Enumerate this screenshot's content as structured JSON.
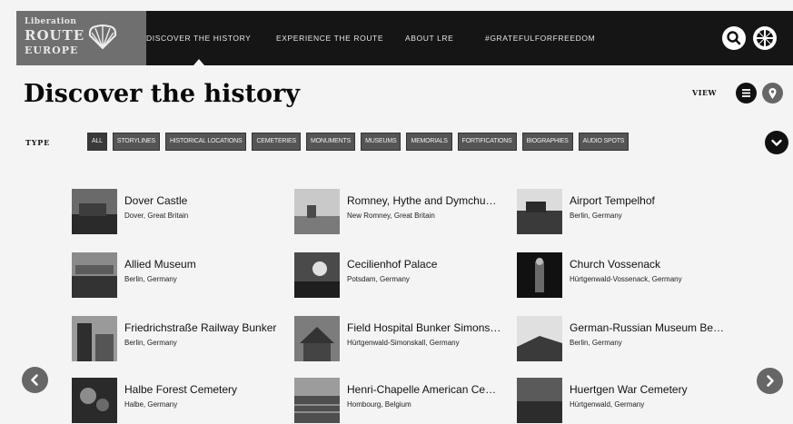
{
  "header": {
    "logo": {
      "line1": "Liberation",
      "line2": "ROUTE",
      "line3": "EUROPE"
    },
    "nav": [
      {
        "label": "DISCOVER THE HISTORY",
        "active": true
      },
      {
        "label": "EXPERIENCE THE ROUTE",
        "active": false
      },
      {
        "label": "ABOUT LRE",
        "active": false
      },
      {
        "label": "#GRATEFULFORFREEDOM",
        "active": false
      }
    ],
    "icons": [
      "search-icon",
      "language-icon"
    ]
  },
  "page": {
    "title": "Discover the history",
    "view_label": "VIEW",
    "view_icons": [
      "list-view-icon",
      "map-view-icon"
    ]
  },
  "filters": {
    "label": "TYPE",
    "chips": [
      "ALL",
      "STORYLINES",
      "HISTORICAL LOCATIONS",
      "CEMETERIES",
      "MONUMENTS",
      "MUSEUMS",
      "MEMORIALS",
      "FORTIFICATIONS",
      "BIOGRAPHIES",
      "AUDIO SPOTS"
    ],
    "active": "ALL"
  },
  "locations": [
    {
      "name": "Dover Castle",
      "location": "Dover, Great Britain"
    },
    {
      "name": "Romney, Hythe and Dymchu…",
      "location": "New Romney, Great Britain"
    },
    {
      "name": "Airport Tempelhof",
      "location": "Berlin, Germany"
    },
    {
      "name": "Allied Museum",
      "location": "Berlin, Germany"
    },
    {
      "name": "Cecilienhof Palace",
      "location": "Potsdam, Germany"
    },
    {
      "name": "Church Vossenack",
      "location": "Hürtgenwald-Vossenack, Germany"
    },
    {
      "name": "Friedrichstraße Railway Bunker",
      "location": "Berlin, Germany"
    },
    {
      "name": "Field Hospital Bunker Simons…",
      "location": "Hürtgenwald-Simonskall, Germany"
    },
    {
      "name": "German-Russian Museum Be…",
      "location": "Berlin, Germany"
    },
    {
      "name": "Halbe Forest Cemetery",
      "location": "Halbe, Germany"
    },
    {
      "name": "Henri-Chapelle American Ce…",
      "location": "Hombourg, Belgium"
    },
    {
      "name": "Huertgen War Cemetery",
      "location": "Hürtgenwald, Germany"
    }
  ],
  "pagination": {
    "prev_icon": "chevron-left-icon",
    "next_icon": "chevron-right-icon"
  }
}
